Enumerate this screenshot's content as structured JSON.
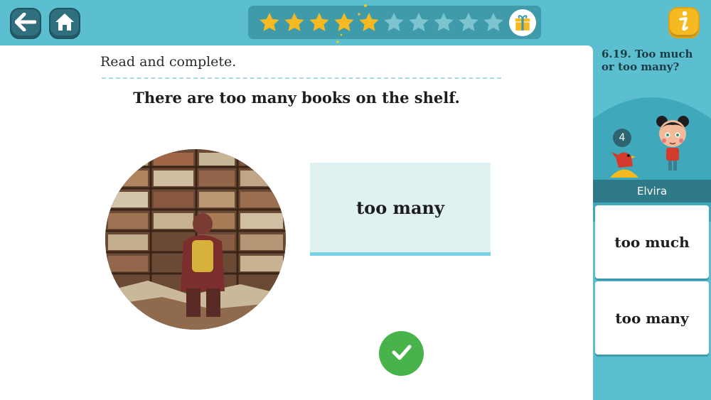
{
  "topbar": {
    "back_icon": "back-arrow-icon",
    "home_icon": "home-icon",
    "info_icon": "info-icon",
    "stars_total": 10,
    "stars_earned": 5,
    "gift_icon": "gift-icon"
  },
  "lesson": {
    "title": "6.19. Too much or too many?",
    "instruction": "Read and complete.",
    "sentence": "There are too many books on the shelf.",
    "answer": "too many"
  },
  "profile": {
    "name": "Elvira",
    "level": "4"
  },
  "options": [
    {
      "label": "too much"
    },
    {
      "label": "too many"
    }
  ],
  "colors": {
    "accent": "#5bbfd0",
    "star_on": "#f5b921",
    "star_off": "#7cc4cf",
    "check": "#48b34a",
    "answer_bg": "#dff1f1"
  }
}
